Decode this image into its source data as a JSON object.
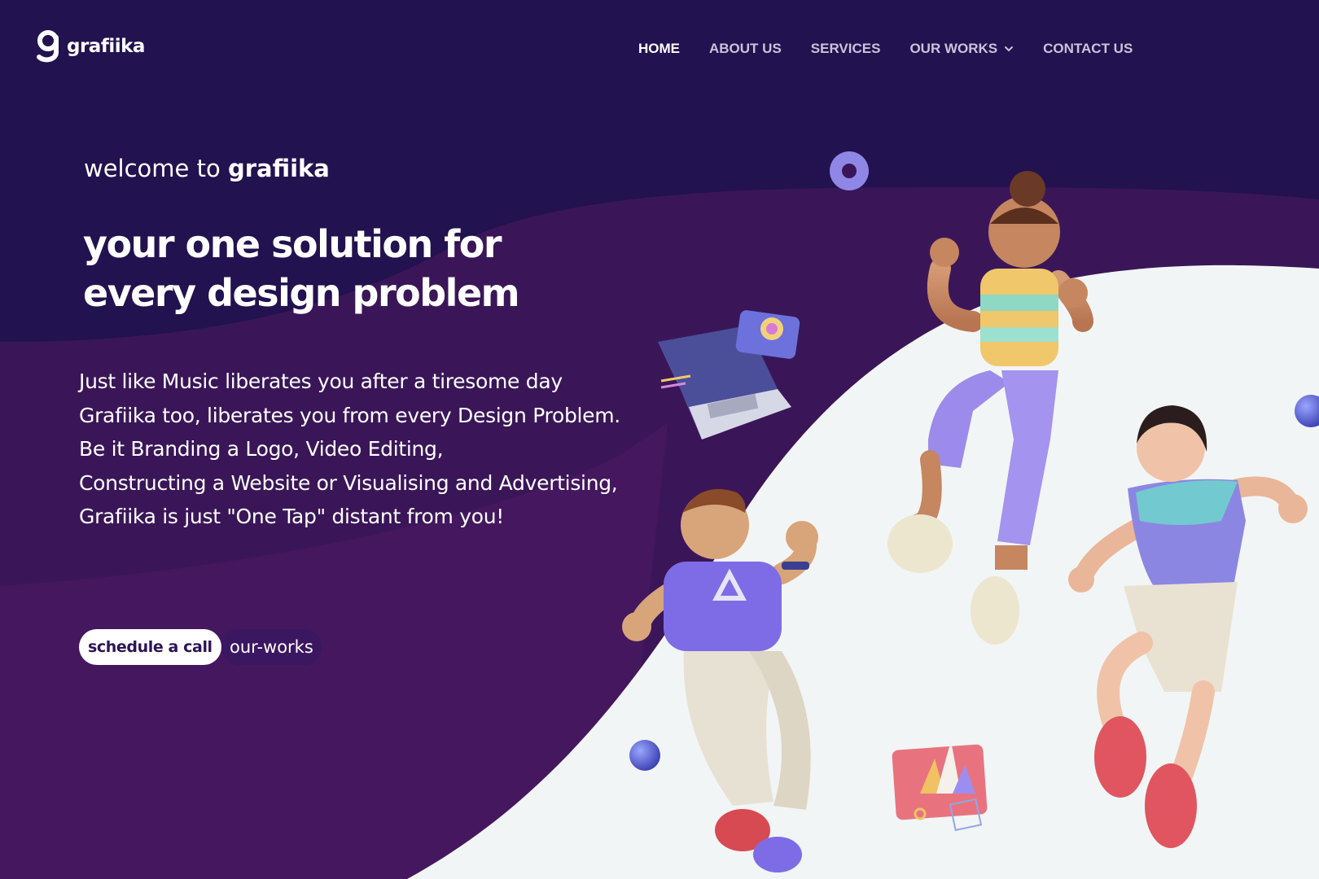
{
  "brand": {
    "name": "grafiika"
  },
  "nav": {
    "items": [
      {
        "label": "HOME",
        "active": true
      },
      {
        "label": "ABOUT US"
      },
      {
        "label": "SERVICES"
      },
      {
        "label": "OUR WORKS",
        "dropdown": true
      },
      {
        "label": "CONTACT US"
      }
    ]
  },
  "hero": {
    "welcome_prefix": "welcome to",
    "welcome_brand": "grafiika",
    "headline_line1": "your one solution for",
    "headline_line2": "every design problem",
    "description": [
      "Just like Music liberates you after a tiresome day",
      "Grafiika too, liberates you from every Design Problem.",
      "Be it Branding a Logo, Video Editing,",
      "Constructing a Website or Visualising and Advertising,",
      "Grafiika is just \"One Tap\" distant from you!"
    ],
    "cta_primary": "schedule a call",
    "cta_secondary": "our-works"
  },
  "colors": {
    "background": "#22124f",
    "purple_wave": "#4a165e",
    "white_wave": "#f2f5f5",
    "text": "#ffffff",
    "accent": "#8b6fe0"
  }
}
